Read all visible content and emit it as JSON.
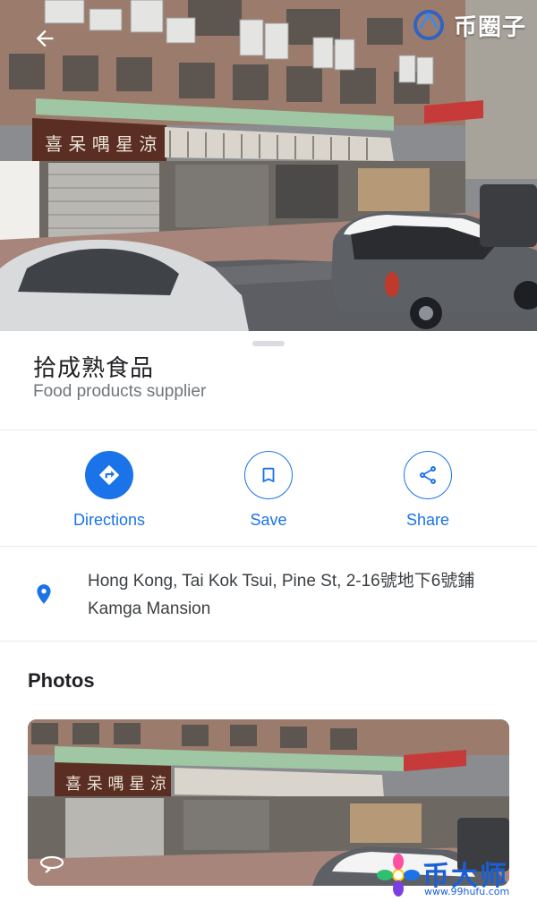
{
  "place": {
    "name": "拾成熟食品",
    "category": "Food products supplier",
    "address": "Hong Kong, Tai Kok Tsui, Pine St, 2-16號地下6號鋪 Kamga Mansion"
  },
  "actions": [
    {
      "label": "Directions",
      "icon": "directions-icon",
      "style": "filled"
    },
    {
      "label": "Save",
      "icon": "bookmark-icon",
      "style": "outlined"
    },
    {
      "label": "Share",
      "icon": "share-icon",
      "style": "outlined"
    }
  ],
  "photos": {
    "heading": "Photos"
  },
  "watermarks": {
    "top": "币圈子",
    "bottom": "币大师",
    "bottom_url": "www.99hufu.com"
  },
  "colors": {
    "accent": "#1a73e8",
    "text_primary": "#202124",
    "text_secondary": "#70757a"
  }
}
